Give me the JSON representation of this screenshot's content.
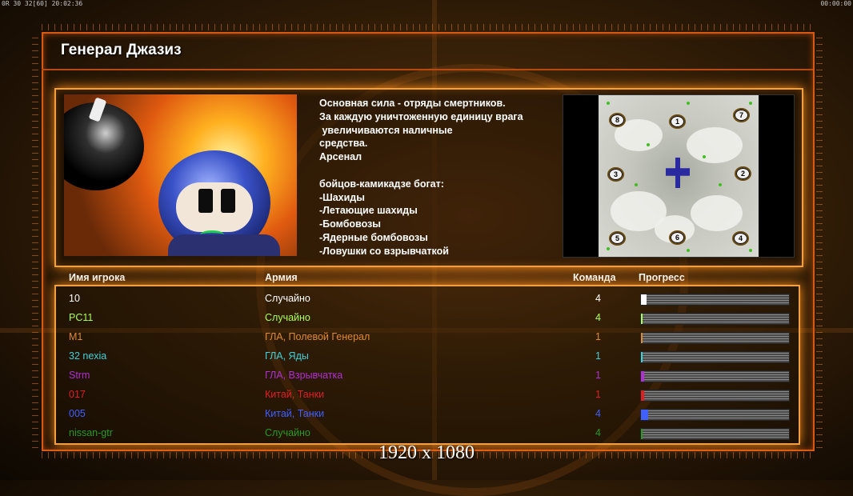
{
  "topbar": {
    "left": "0R 30 32[60] 20:02:36",
    "right": "00:00:00"
  },
  "general": {
    "title": "Генерал Джазиз"
  },
  "description": "Основная сила - отряды смертников.\nЗа каждую уничтоженную единицу врага\n увеличиваются наличные\nсредства.\nАрсенал\n\nбойцов-камикадзе богат:\n-Шахиды\n-Летающие шахиды\n-Бомбовозы\n-Ядерные бомбовозы\n-Ловушки со взрывчаткой",
  "minimap": {
    "start_positions": [
      "8",
      "1",
      "7",
      "3",
      "2",
      "5",
      "6",
      "4"
    ]
  },
  "table": {
    "headers": {
      "name": "Имя игрока",
      "army": "Армия",
      "team": "Команда",
      "progress": "Прогресс"
    },
    "rows": [
      {
        "name": "10",
        "army": "Случайно",
        "team": "4",
        "color": "#ffffff",
        "progress": 0.04
      },
      {
        "name": "PC11",
        "army": "Случайно",
        "team": "4",
        "color": "#aaff55",
        "progress": 0.01
      },
      {
        "name": "M1",
        "army": "ГЛА, Полевой Генерал",
        "team": "1",
        "color": "#e08a30",
        "progress": 0.01
      },
      {
        "name": "32 nexia",
        "army": "ГЛА, Яды",
        "team": "1",
        "color": "#40d0d8",
        "progress": 0.01
      },
      {
        "name": "Strm",
        "army": "ГЛА, Взрывчатка",
        "team": "1",
        "color": "#b030d0",
        "progress": 0.02
      },
      {
        "name": "017",
        "army": "Китай, Танки",
        "team": "1",
        "color": "#e02020",
        "progress": 0.02
      },
      {
        "name": "005",
        "army": "Китай, Танки",
        "team": "4",
        "color": "#4060ff",
        "progress": 0.05
      },
      {
        "name": "nissan-gtr",
        "army": "Случайно",
        "team": "4",
        "color": "#2a9a20",
        "progress": 0.01
      }
    ]
  },
  "resolution_label": "1920 x 1080"
}
